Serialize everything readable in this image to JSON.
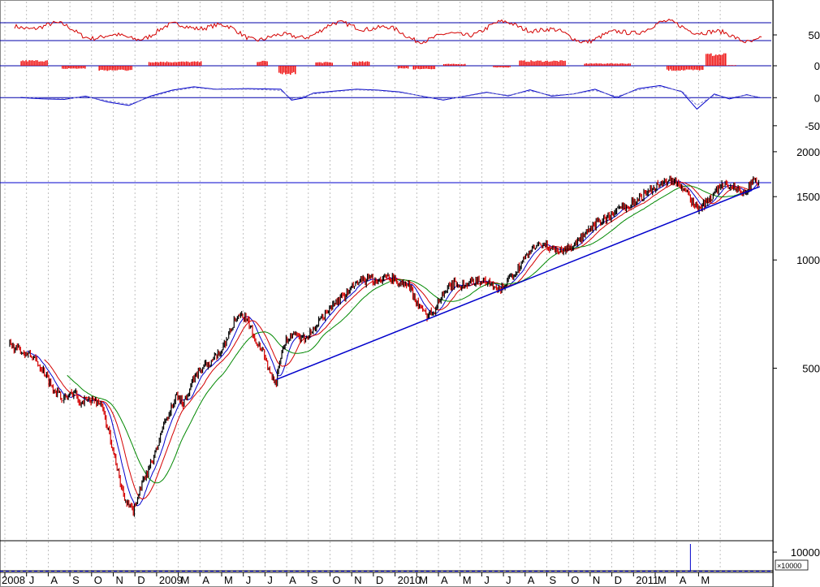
{
  "chart_data": [
    {
      "panel": "oscillator-1",
      "type": "line",
      "yticks": [
        50
      ],
      "reference_lines": [
        62,
        38
      ],
      "ylim": [
        25,
        75
      ],
      "line_color": "#d40000",
      "ref_color": "#0000aa"
    },
    {
      "panel": "histogram",
      "type": "bar",
      "yticks": [
        0
      ],
      "bar_color": "#ee0000",
      "segments": [
        {
          "from": 0.5,
          "to": 1.7,
          "level": 0.9
        },
        {
          "from": 2.4,
          "to": 3.5,
          "level": -0.5
        },
        {
          "from": 4.1,
          "to": 5.6,
          "level": -0.8
        },
        {
          "from": 6.4,
          "to": 8.8,
          "level": 0.7
        },
        {
          "from": 11.4,
          "to": 11.9,
          "level": 0.8
        },
        {
          "from": 12.4,
          "to": 13.2,
          "level": -1.4
        },
        {
          "from": 14.1,
          "to": 14.9,
          "level": 0.6
        },
        {
          "from": 15.8,
          "to": 16.6,
          "level": 0.7
        },
        {
          "from": 17.9,
          "to": 18.4,
          "level": -0.5
        },
        {
          "from": 18.6,
          "to": 19.6,
          "level": -0.6
        },
        {
          "from": 20.0,
          "to": 21.0,
          "level": 0.3
        },
        {
          "from": 22.3,
          "to": 23.1,
          "level": -0.3
        },
        {
          "from": 23.5,
          "to": 25.6,
          "level": 0.85
        },
        {
          "from": 26.5,
          "to": 28.6,
          "level": 0.4
        },
        {
          "from": 30.3,
          "to": 32.0,
          "level": -0.8
        },
        {
          "from": 32.1,
          "to": 33.0,
          "level": 2.0
        },
        {
          "from": 33.0,
          "to": 33.5,
          "level": 0.1
        }
      ]
    },
    {
      "panel": "oscillator-2",
      "type": "line",
      "yticks": [
        0,
        -50
      ],
      "reference_lines": [
        0
      ],
      "ylim": [
        -80,
        60
      ],
      "series": [
        {
          "color": "#0000cc",
          "values": [
            [
              0.5,
              0
            ],
            [
              1.5,
              -4
            ],
            [
              2.5,
              -6
            ],
            [
              3.5,
              5
            ],
            [
              4.5,
              -14
            ],
            [
              5.5,
              -26
            ],
            [
              6.5,
              5
            ],
            [
              7.5,
              25
            ],
            [
              8.5,
              36
            ],
            [
              9.5,
              28
            ],
            [
              11,
              30
            ],
            [
              12.5,
              28
            ],
            [
              13,
              -8
            ],
            [
              13.5,
              -2
            ],
            [
              14,
              15
            ],
            [
              15,
              22
            ],
            [
              16,
              28
            ],
            [
              17,
              25
            ],
            [
              18,
              19
            ],
            [
              19,
              5
            ],
            [
              20,
              -8
            ],
            [
              21,
              5
            ],
            [
              22,
              18
            ],
            [
              23,
              6
            ],
            [
              24,
              26
            ],
            [
              25,
              5
            ],
            [
              26,
              12
            ],
            [
              27,
              28
            ],
            [
              28,
              0
            ],
            [
              29,
              30
            ],
            [
              30,
              40
            ],
            [
              31,
              20
            ],
            [
              31.7,
              -38
            ],
            [
              32.5,
              12
            ],
            [
              33.2,
              -4
            ],
            [
              34,
              10
            ],
            [
              34.6,
              0
            ]
          ]
        },
        {
          "color": "#8888cc",
          "values": [
            [
              0.5,
              2
            ],
            [
              1.5,
              -2
            ],
            [
              2.5,
              -4
            ],
            [
              3.5,
              3
            ],
            [
              4.5,
              -10
            ],
            [
              5.5,
              -22
            ],
            [
              6.5,
              2
            ],
            [
              7.5,
              22
            ],
            [
              8.5,
              33
            ],
            [
              9.5,
              27
            ],
            [
              11,
              28
            ],
            [
              12.5,
              24
            ],
            [
              13,
              -4
            ],
            [
              14,
              12
            ],
            [
              15,
              20
            ],
            [
              16,
              26
            ],
            [
              17,
              23
            ],
            [
              18,
              17
            ],
            [
              19,
              6
            ],
            [
              20,
              -6
            ],
            [
              21,
              4
            ],
            [
              22,
              16
            ],
            [
              23,
              8
            ],
            [
              24,
              22
            ],
            [
              25,
              8
            ],
            [
              26,
              12
            ],
            [
              27,
              24
            ],
            [
              28,
              4
            ],
            [
              29,
              26
            ],
            [
              30,
              36
            ],
            [
              31,
              22
            ],
            [
              31.7,
              -25
            ],
            [
              32.5,
              8
            ],
            [
              33.2,
              0
            ],
            [
              34,
              8
            ],
            [
              34.6,
              2
            ]
          ]
        }
      ]
    },
    {
      "panel": "price",
      "type": "line",
      "scale": "log",
      "yticks": [
        2000,
        1500,
        1000,
        500
      ],
      "ylim": [
        180,
        2300
      ],
      "resistance_level": 1640,
      "x_month_labels": [
        "2008",
        "J",
        "A",
        "S",
        "O",
        "N",
        "D",
        "2009",
        "M",
        "A",
        "M",
        "J",
        "J",
        "A",
        "S",
        "O",
        "N",
        "D",
        "2010",
        "M",
        "A",
        "M",
        "J",
        "J",
        "A",
        "S",
        "O",
        "N",
        "D",
        "2011",
        "M",
        "A",
        "M"
      ],
      "price_anchors": [
        [
          0,
          580
        ],
        [
          1,
          540
        ],
        [
          1.5,
          500
        ],
        [
          2,
          440
        ],
        [
          2.5,
          410
        ],
        [
          3,
          430
        ],
        [
          3.3,
          400
        ],
        [
          3.7,
          410
        ],
        [
          4.2,
          400
        ],
        [
          4.7,
          310
        ],
        [
          5.1,
          240
        ],
        [
          5.4,
          210
        ],
        [
          5.7,
          200
        ],
        [
          6,
          230
        ],
        [
          6.4,
          260
        ],
        [
          6.8,
          300
        ],
        [
          7.1,
          350
        ],
        [
          7.4,
          380
        ],
        [
          7.7,
          420
        ],
        [
          8,
          400
        ],
        [
          8.3,
          440
        ],
        [
          8.6,
          480
        ],
        [
          8.9,
          500
        ],
        [
          9.2,
          520
        ],
        [
          9.6,
          540
        ],
        [
          10,
          600
        ],
        [
          10.4,
          680
        ],
        [
          10.8,
          700
        ],
        [
          11.1,
          650
        ],
        [
          11.4,
          590
        ],
        [
          11.7,
          560
        ],
        [
          12,
          480
        ],
        [
          12.3,
          460
        ],
        [
          12.6,
          580
        ],
        [
          13,
          620
        ],
        [
          13.5,
          600
        ],
        [
          14,
          640
        ],
        [
          14.5,
          700
        ],
        [
          15,
          760
        ],
        [
          15.5,
          800
        ],
        [
          16,
          860
        ],
        [
          16.5,
          880
        ],
        [
          17,
          880
        ],
        [
          17.5,
          900
        ],
        [
          18,
          860
        ],
        [
          18.4,
          850
        ],
        [
          18.8,
          760
        ],
        [
          19.2,
          700
        ],
        [
          19.6,
          730
        ],
        [
          20,
          810
        ],
        [
          20.5,
          860
        ],
        [
          21,
          850
        ],
        [
          21.5,
          880
        ],
        [
          22,
          870
        ],
        [
          22.5,
          820
        ],
        [
          23,
          870
        ],
        [
          23.5,
          960
        ],
        [
          24,
          1060
        ],
        [
          24.5,
          1100
        ],
        [
          25,
          1080
        ],
        [
          25.5,
          1060
        ],
        [
          26,
          1100
        ],
        [
          26.5,
          1160
        ],
        [
          27,
          1260
        ],
        [
          27.5,
          1300
        ],
        [
          28,
          1370
        ],
        [
          28.5,
          1420
        ],
        [
          29,
          1480
        ],
        [
          29.5,
          1560
        ],
        [
          30,
          1630
        ],
        [
          30.5,
          1680
        ],
        [
          31,
          1600
        ],
        [
          31.5,
          1450
        ],
        [
          31.8,
          1380
        ],
        [
          32.2,
          1460
        ],
        [
          32.6,
          1560
        ],
        [
          33,
          1620
        ],
        [
          33.4,
          1600
        ],
        [
          33.8,
          1520
        ],
        [
          34.2,
          1640
        ],
        [
          34.6,
          1650
        ]
      ],
      "trend_line": [
        [
          12.3,
          465
        ],
        [
          34.6,
          1600
        ]
      ],
      "colors": {
        "price": "#000000",
        "price_down": "#d40000",
        "ma_short": "#0000cc",
        "ma_mid": "#d40000",
        "ma_long": "#008800",
        "trend": "#0000cc",
        "resistance": "#0000cc"
      }
    },
    {
      "panel": "volume",
      "type": "bar",
      "yticks": [
        10000
      ],
      "unit_label": "×10000",
      "spike_month": 31.4
    }
  ]
}
